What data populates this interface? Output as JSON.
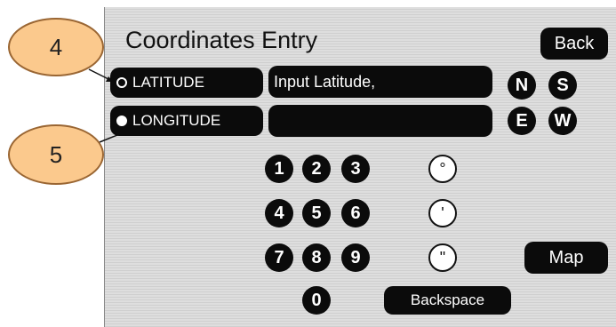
{
  "title": "Coordinates Entry",
  "back_label": "Back",
  "latitude_label": "LATITUDE",
  "longitude_label": "LONGITUDE",
  "latitude_value": "Input Latitude,",
  "longitude_value": "",
  "directions": {
    "n": "N",
    "s": "S",
    "e": "E",
    "w": "W"
  },
  "digits": {
    "d1": "1",
    "d2": "2",
    "d3": "3",
    "d4": "4",
    "d5": "5",
    "d6": "6",
    "d7": "7",
    "d8": "8",
    "d9": "9",
    "d0": "0"
  },
  "symbols": {
    "degree": "°",
    "minute": "'",
    "second": "\""
  },
  "map_label": "Map",
  "backspace_label": "Backspace",
  "callouts": {
    "c4": "4",
    "c5": "5"
  }
}
